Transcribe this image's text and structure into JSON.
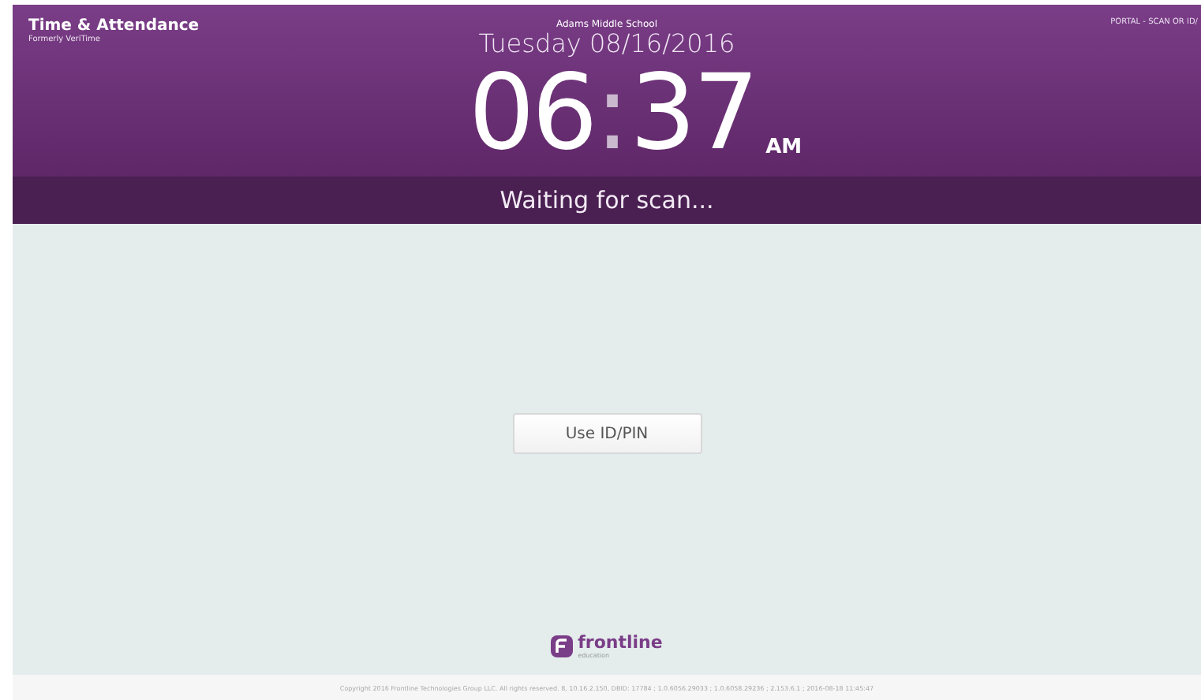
{
  "header": {
    "app_title": "Time & Attendance",
    "app_subtitle": "Formerly VeriTime",
    "school": "Adams Middle School",
    "date": "Tuesday 08/16/2016",
    "clock": {
      "hours": "06",
      "separator": ":",
      "minutes": "37",
      "period": "AM"
    },
    "mode": "PORTAL - SCAN OR ID/"
  },
  "status": "Waiting for scan...",
  "button": "Use ID/PIN",
  "logo": {
    "name": "frontline",
    "tagline": "education"
  },
  "footer": "Copyright 2016 Frontline Technologies Group LLC. All rights reserved. 8, 10.16.2.150, DBID: 17784 ; 1.0.6056.29033 ; 1.0.6058.29236 ; 2.153.6.1 ; 2016-08-18 11:45:47"
}
